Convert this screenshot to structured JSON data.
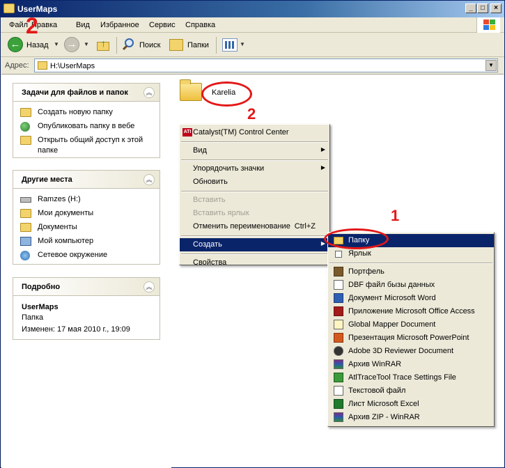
{
  "window": {
    "title": "UserMaps"
  },
  "menubar": {
    "items": [
      "Файл",
      "Правка",
      "Вид",
      "Избранное",
      "Сервис",
      "Справка"
    ]
  },
  "toolbar": {
    "back_label": "Назад",
    "search_label": "Поиск",
    "folders_label": "Папки"
  },
  "address": {
    "label": "Адрес:",
    "path": "H:\\UserMaps"
  },
  "tasks_panel": {
    "title": "Задачи для файлов и папок",
    "items": [
      "Создать новую папку",
      "Опубликовать папку в вебе",
      "Открыть общий доступ к этой",
      "папке"
    ]
  },
  "other_places": {
    "title": "Другие места",
    "items": [
      "Ramzes (H:)",
      "Мои документы",
      "Документы",
      "Мой компьютер",
      "Сетевое окружение"
    ]
  },
  "details": {
    "title": "Подробно",
    "name": "UserMaps",
    "type": "Папка",
    "modified": "Изменен: 17 мая 2010 г., 19:09"
  },
  "folder": {
    "name": "Karelia"
  },
  "annotations": {
    "num1": "1",
    "num2": "2"
  },
  "context_menu": {
    "catalyst": "Catalyst(TM) Control Center",
    "view": "Вид",
    "arrange": "Упорядочить значки",
    "refresh": "Обновить",
    "paste": "Вставить",
    "paste_shortcut": "Вставить ярлык",
    "undo_rename": "Отменить переименование",
    "undo_shortcut": "Ctrl+Z",
    "create": "Создать",
    "properties": "Свойства"
  },
  "create_submenu": {
    "folder": "Папку",
    "shortcut": "Ярлык",
    "items": [
      "Портфель",
      "DBF файл бызы данных",
      "Документ Microsoft Word",
      "Приложение Microsoft Office Access",
      "Global Mapper Document",
      "Презентация Microsoft PowerPoint",
      "Adobe 3D Reviewer Document",
      "Архив WinRAR",
      "AtlTraceTool Trace Settings File",
      "Текстовой файл",
      "Лист Microsoft Excel",
      "Архив ZIP - WinRAR"
    ]
  },
  "colors": {
    "title_bar": "#0a246a",
    "highlight": "#0a246a",
    "annotation": "#e31818",
    "menu_bg": "#ece9d8"
  }
}
